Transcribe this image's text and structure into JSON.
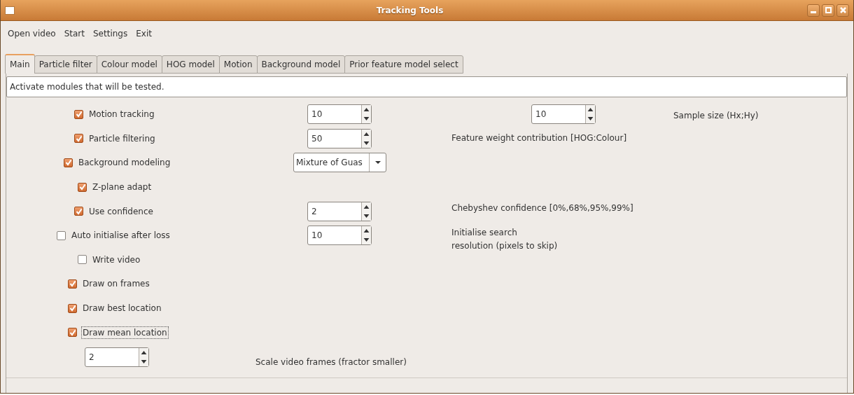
{
  "window": {
    "title": "Tracking Tools"
  },
  "menu": [
    "Open video",
    "Start",
    "Settings",
    "Exit"
  ],
  "tabs": [
    {
      "label": "Main",
      "selected": true
    },
    {
      "label": "Particle filter",
      "selected": false
    },
    {
      "label": "Colour model",
      "selected": false
    },
    {
      "label": "HOG model",
      "selected": false
    },
    {
      "label": "Motion",
      "selected": false
    },
    {
      "label": "Background model",
      "selected": false
    },
    {
      "label": "Prior feature model select",
      "selected": false
    }
  ],
  "info": "Activate modules that will be tested.",
  "rows": [
    {
      "option": {
        "label": "Motion tracking",
        "checked": true
      },
      "spin": "10",
      "spin_2": "10",
      "note": "Sample size (Hx;Hy)"
    },
    {
      "option": {
        "label": "Particle filtering",
        "checked": true
      },
      "spin": "50",
      "note": "Feature weight contribution [HOG:Colour]"
    },
    {
      "option": {
        "label": "Background modeling",
        "checked": true
      },
      "combo": "Mixture of Guas"
    },
    {
      "option": {
        "label": "Z-plane adapt",
        "checked": true
      }
    },
    {
      "option": {
        "label": "Use confidence",
        "checked": true
      },
      "spin": "2",
      "note": "Chebyshev confidence [0%,68%,95%,99%]"
    },
    {
      "option": {
        "label": "Auto initialise after loss",
        "checked": false
      },
      "spin": "10",
      "note": "Initialise search\nresolution (pixels to skip)"
    },
    {
      "option": {
        "label": "Write video",
        "checked": false
      }
    },
    {
      "option": {
        "label": "Draw on frames",
        "checked": true
      }
    },
    {
      "option": {
        "label": "Draw best location",
        "checked": true
      }
    },
    {
      "option": {
        "label": "Draw mean location",
        "checked": true,
        "focused": true
      }
    }
  ],
  "scale": {
    "spin": "2",
    "label": "Scale video frames (fractor smaller)"
  }
}
